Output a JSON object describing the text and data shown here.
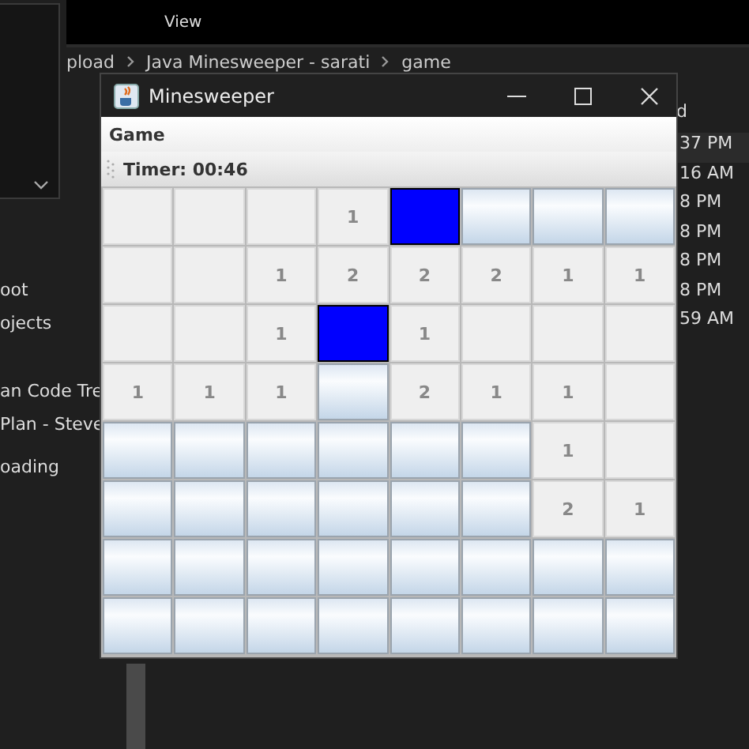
{
  "explorer": {
    "menu": [
      "View"
    ],
    "breadcrumb": [
      "pload",
      "Java Minesweeper - sarati",
      "game"
    ],
    "sidebar": [
      "oot",
      "ojects",
      "an Code Tre",
      "Plan - Steve",
      "oading"
    ],
    "column_header": "d",
    "times": [
      "37 PM",
      "16 AM",
      "8 PM",
      "8 PM",
      "8 PM",
      "8 PM",
      "59 AM"
    ]
  },
  "window": {
    "title": "Minesweeper",
    "menu": [
      "Game"
    ],
    "timer": "Timer: 00:46"
  },
  "board": [
    [
      {
        "kind": "open"
      },
      {
        "kind": "open"
      },
      {
        "kind": "open"
      },
      {
        "kind": "open",
        "text": "1"
      },
      {
        "kind": "flag"
      },
      {
        "kind": "hidden"
      },
      {
        "kind": "hidden"
      },
      {
        "kind": "hidden"
      }
    ],
    [
      {
        "kind": "open"
      },
      {
        "kind": "open"
      },
      {
        "kind": "open",
        "text": "1"
      },
      {
        "kind": "open",
        "text": "2"
      },
      {
        "kind": "open",
        "text": "2"
      },
      {
        "kind": "open",
        "text": "2"
      },
      {
        "kind": "open",
        "text": "1"
      },
      {
        "kind": "open",
        "text": "1"
      }
    ],
    [
      {
        "kind": "open"
      },
      {
        "kind": "open"
      },
      {
        "kind": "open",
        "text": "1"
      },
      {
        "kind": "flag"
      },
      {
        "kind": "open",
        "text": "1"
      },
      {
        "kind": "open"
      },
      {
        "kind": "open"
      },
      {
        "kind": "open"
      }
    ],
    [
      {
        "kind": "open",
        "text": "1"
      },
      {
        "kind": "open",
        "text": "1"
      },
      {
        "kind": "open",
        "text": "1"
      },
      {
        "kind": "hidden"
      },
      {
        "kind": "open",
        "text": "2"
      },
      {
        "kind": "open",
        "text": "1"
      },
      {
        "kind": "open",
        "text": "1"
      },
      {
        "kind": "open"
      }
    ],
    [
      {
        "kind": "hidden"
      },
      {
        "kind": "hidden"
      },
      {
        "kind": "hidden"
      },
      {
        "kind": "hidden"
      },
      {
        "kind": "hidden"
      },
      {
        "kind": "hidden"
      },
      {
        "kind": "open",
        "text": "1"
      },
      {
        "kind": "open"
      }
    ],
    [
      {
        "kind": "hidden"
      },
      {
        "kind": "hidden"
      },
      {
        "kind": "hidden"
      },
      {
        "kind": "hidden"
      },
      {
        "kind": "hidden"
      },
      {
        "kind": "hidden"
      },
      {
        "kind": "open",
        "text": "2"
      },
      {
        "kind": "open",
        "text": "1"
      }
    ],
    [
      {
        "kind": "hidden"
      },
      {
        "kind": "hidden"
      },
      {
        "kind": "hidden"
      },
      {
        "kind": "hidden"
      },
      {
        "kind": "hidden"
      },
      {
        "kind": "hidden"
      },
      {
        "kind": "hidden"
      },
      {
        "kind": "hidden"
      }
    ],
    [
      {
        "kind": "hidden"
      },
      {
        "kind": "hidden"
      },
      {
        "kind": "hidden"
      },
      {
        "kind": "hidden"
      },
      {
        "kind": "hidden"
      },
      {
        "kind": "hidden"
      },
      {
        "kind": "hidden"
      },
      {
        "kind": "hidden"
      }
    ]
  ]
}
